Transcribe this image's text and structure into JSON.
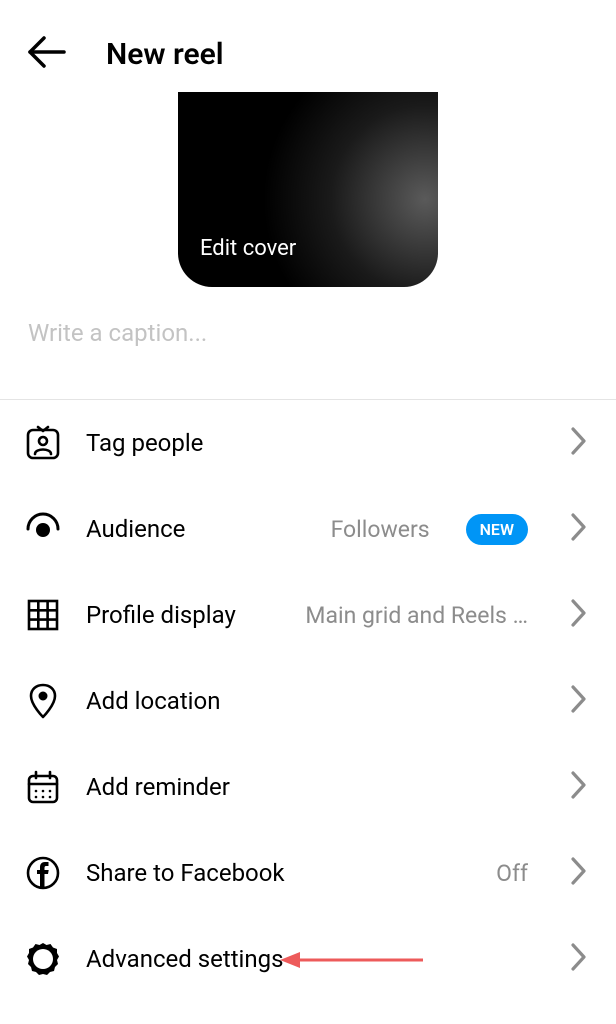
{
  "header": {
    "title": "New reel"
  },
  "cover": {
    "edit_label": "Edit cover"
  },
  "caption": {
    "placeholder": "Write a caption..."
  },
  "options": {
    "tag_people": {
      "label": "Tag people"
    },
    "audience": {
      "label": "Audience",
      "value": "Followers",
      "badge": "NEW"
    },
    "profile_display": {
      "label": "Profile display",
      "value": "Main grid and Reels …"
    },
    "add_location": {
      "label": "Add location"
    },
    "add_reminder": {
      "label": "Add reminder"
    },
    "share_facebook": {
      "label": "Share to Facebook",
      "value": "Off"
    },
    "advanced_settings": {
      "label": "Advanced settings"
    }
  }
}
